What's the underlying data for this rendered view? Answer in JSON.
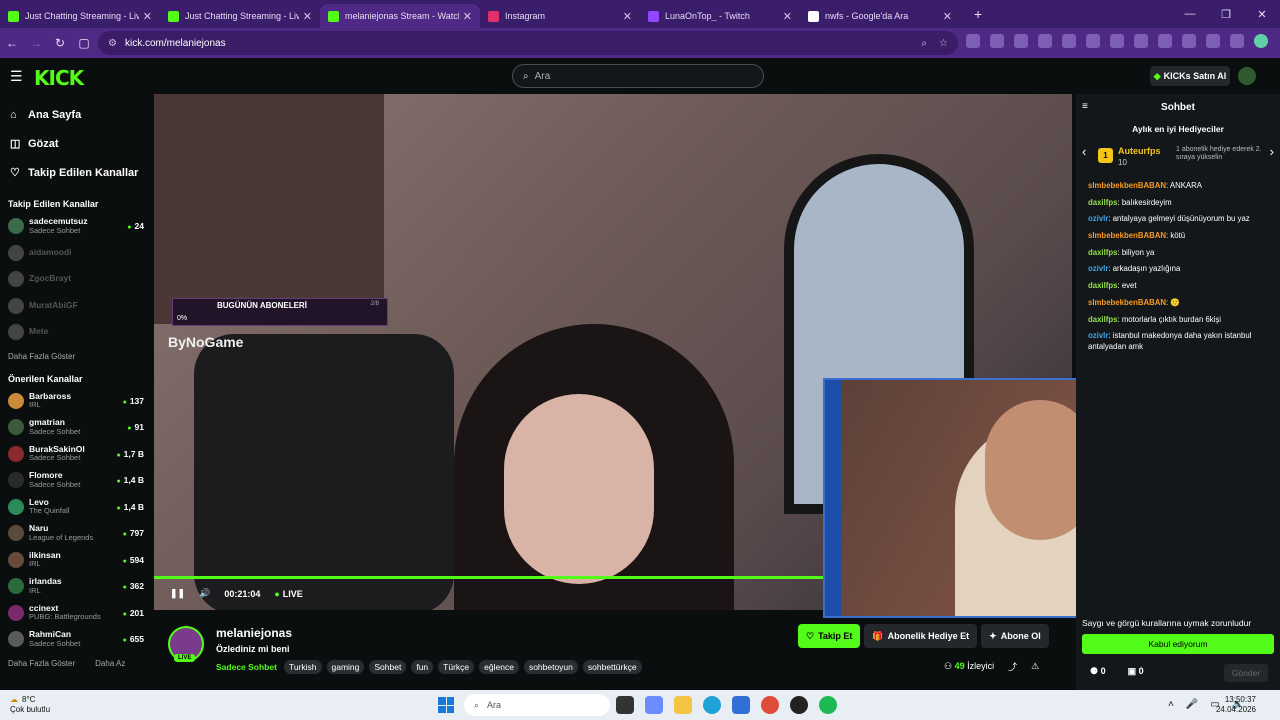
{
  "browser": {
    "tabs": [
      {
        "title": "Just Chatting Streaming - Live S",
        "color": "#53fc18",
        "active": false
      },
      {
        "title": "Just Chatting Streaming - Live S",
        "color": "#53fc18",
        "active": false
      },
      {
        "title": "melaniejonas Stream - Watch",
        "color": "#53fc18",
        "active": true
      },
      {
        "title": "Instagram",
        "color": "#e1306c",
        "active": false
      },
      {
        "title": "LunaOnTop_ - Twitch",
        "color": "#9146ff",
        "active": false
      },
      {
        "title": "nwfs - Google'da Ara",
        "color": "#ffffff",
        "active": false
      }
    ],
    "url": "kick.com/melaniejonas"
  },
  "header": {
    "logo": "KICK",
    "search_placeholder": "Ara",
    "buy_kicks": "KICKs Satın Al"
  },
  "sidebar": {
    "nav": [
      {
        "icon": "home-icon",
        "label": "Ana Sayfa"
      },
      {
        "icon": "compass-icon",
        "label": "Gözat"
      },
      {
        "icon": "heart-icon",
        "label": "Takip Edilen Kanallar"
      }
    ],
    "followed_title": "Takip Edilen Kanallar",
    "followed": [
      {
        "name": "sadecemutsuz",
        "sub": "Sadece Sohbet",
        "viewers": "24",
        "live": true,
        "color": "#3a6b4a"
      },
      {
        "name": "aidamoodi",
        "sub": "",
        "viewers": "",
        "live": false,
        "color": "#444"
      },
      {
        "name": "ZgocBrayt",
        "sub": "",
        "viewers": "",
        "live": false,
        "color": "#444"
      },
      {
        "name": "MuratAbiGF",
        "sub": "",
        "viewers": "",
        "live": false,
        "color": "#444"
      },
      {
        "name": "Mete",
        "sub": "",
        "viewers": "",
        "live": false,
        "color": "#444"
      }
    ],
    "more_label": "Daha Fazla Göster",
    "recommended_title": "Önerilen Kanallar",
    "recommended": [
      {
        "name": "Barbaross",
        "sub": "IRL",
        "viewers": "137",
        "color": "#c98a3a"
      },
      {
        "name": "gmatrian",
        "sub": "Sadece Sohbet",
        "viewers": "91",
        "color": "#3a5a3a"
      },
      {
        "name": "BurakSakinOl",
        "sub": "Sadece Sohbet",
        "viewers": "1,7 B",
        "color": "#8a2a2a"
      },
      {
        "name": "Flomore",
        "sub": "Sadece Sohbet",
        "viewers": "1,4 B",
        "color": "#2a2a2a"
      },
      {
        "name": "Levo",
        "sub": "The Quinfall",
        "viewers": "1,4 B",
        "color": "#2a8a5a"
      },
      {
        "name": "Naru",
        "sub": "League of Legends",
        "viewers": "797",
        "color": "#5a4a3a"
      },
      {
        "name": "ilkinsan",
        "sub": "IRL",
        "viewers": "594",
        "color": "#6a4a3a"
      },
      {
        "name": "irlandas",
        "sub": "IRL",
        "viewers": "362",
        "color": "#2a6a3a"
      },
      {
        "name": "ccinext",
        "sub": "PUBG: Battlegrounds",
        "viewers": "201",
        "color": "#7a2a6a"
      },
      {
        "name": "RahmiCan",
        "sub": "Sadece Sohbet",
        "viewers": "655",
        "color": "#5a5a5a"
      }
    ],
    "more_label2": "Daha Fazla Göster",
    "less_label": "Daha Az"
  },
  "player": {
    "overlay_title": "BUGÜNÜN ABONELERİ",
    "overlay_percent": "0%",
    "overlay_count": "2/8",
    "sponsor": "ByNoGame",
    "time": "00:21:04",
    "live": "LIVE",
    "progress": 1.0
  },
  "stream": {
    "username": "melaniejonas",
    "live_badge": "LIVE",
    "title": "Özlediniz mi beni",
    "category": "Sadece Sohbet",
    "tags": [
      "Turkish",
      "gaming",
      "Sohbet",
      "fun",
      "Türkçe",
      "eğlence",
      "sohbetoyun",
      "sohbettürkçe"
    ],
    "follow": "Takip Et",
    "gift_sub": "Abonelik Hediye Et",
    "subscribe": "Abone Ol",
    "viewers": "49",
    "viewers_label": "İzleyici"
  },
  "chat": {
    "title": "Sohbet",
    "gifters_title": "Aylık en iyi Hediyeciler",
    "top_rank": "1",
    "top_name": "Auteurfps",
    "top_count": "10",
    "top_msg": "1 abonelik hediye ederek 2. sıraya yükselin",
    "messages": [
      {
        "user": "slmbebekbenBABAN",
        "color": "#f59b25",
        "text": "ANKARA"
      },
      {
        "user": "daxilfps",
        "color": "#93e04a",
        "text": "balıkesirdeyim"
      },
      {
        "user": "ozivlr",
        "color": "#3fa4e8",
        "text": "antalyaya gelmeyi düşünüyorum bu yaz"
      },
      {
        "user": "slmbebekbenBABAN",
        "color": "#f59b25",
        "text": "kötü"
      },
      {
        "user": "daxilfps",
        "color": "#93e04a",
        "text": "biliyon ya"
      },
      {
        "user": "ozivlr",
        "color": "#3fa4e8",
        "text": "arkadaşın yazlığına"
      },
      {
        "user": "daxilfps",
        "color": "#93e04a",
        "text": "evet"
      },
      {
        "user": "slmbebekbenBABAN",
        "color": "#f59b25",
        "text": "🙂"
      },
      {
        "user": "daxilfps",
        "color": "#93e04a",
        "text": "motorlarla çıktık burdan 6kişi"
      },
      {
        "user": "ozivlr",
        "color": "#3fa4e8",
        "text": "istanbul makedonya daha yakın istanbul antalyadan amk"
      }
    ],
    "rules": "Saygı ve görgü kurallarına uymak zorunludur",
    "accept": "Kabul ediyorum",
    "points": "0",
    "gifts": "0",
    "send": "Gönder"
  },
  "taskbar": {
    "temp": "8°C",
    "weather": "Çok bulutlu",
    "search": "Ara",
    "time": "13:50:37",
    "date": "24.04.2026"
  }
}
